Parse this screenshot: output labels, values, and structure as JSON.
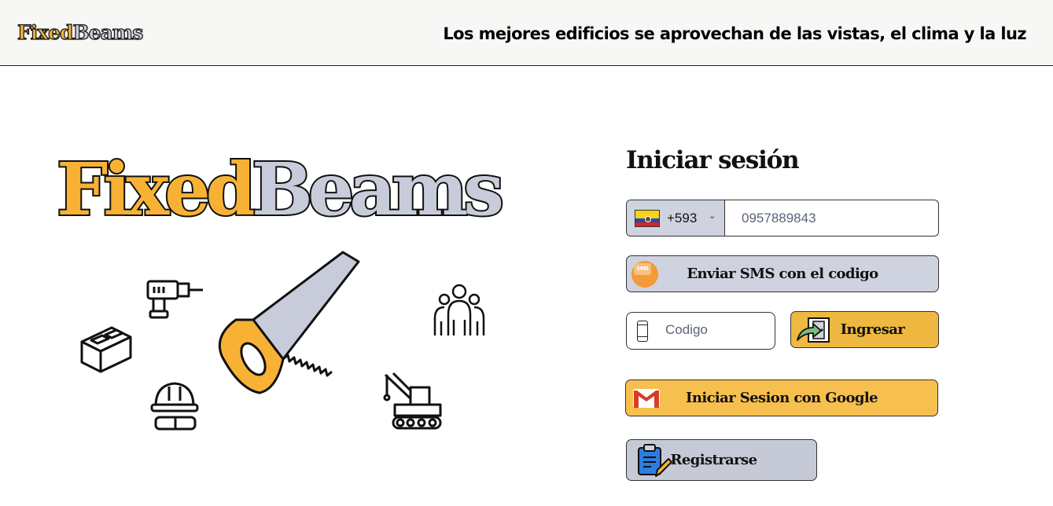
{
  "header": {
    "brand_fixed": "Fixed",
    "brand_beams": "Beams",
    "tagline": "Los mejores edificios se aprovechan de las vistas, el clima y la luz"
  },
  "hero": {
    "title_fixed": "Fixed",
    "title_beams": "Beams",
    "icons": [
      "drill-icon",
      "concrete-block-icon",
      "hard-hat-goggles-icon",
      "saw-icon",
      "people-group-icon",
      "crane-icon"
    ]
  },
  "login": {
    "title": "Iniciar sesión",
    "country_code": "+593",
    "country_flag": "ecuador-flag-icon",
    "phone_value": "0957889843",
    "send_sms_label": "Enviar SMS con el codigo",
    "code_placeholder": "Codigo",
    "enter_label": "Ingresar",
    "google_label": "Iniciar Sesion con Google",
    "register_label": "Registrarse"
  },
  "colors": {
    "accent_yellow": "#f7b235",
    "accent_gray_blue": "#c8ccda",
    "border": "#333333"
  }
}
